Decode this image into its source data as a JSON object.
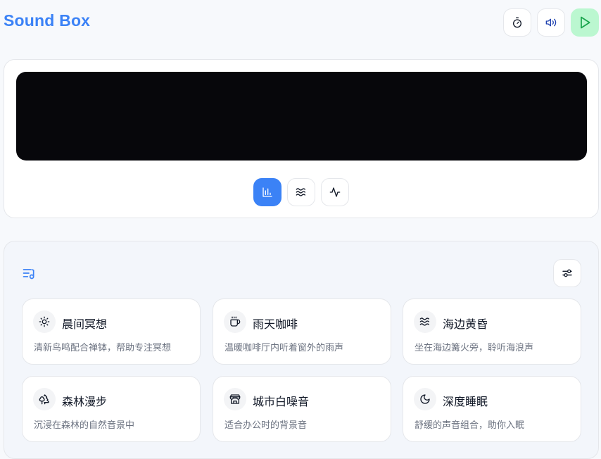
{
  "header": {
    "title": "Sound Box",
    "buttons": [
      {
        "icon": "timer-icon"
      },
      {
        "icon": "volume-icon"
      },
      {
        "icon": "play-icon"
      }
    ]
  },
  "visualizer": {
    "modes": [
      {
        "icon": "bar-chart-icon",
        "active": true
      },
      {
        "icon": "waves-icon",
        "active": false
      },
      {
        "icon": "activity-icon",
        "active": false
      }
    ]
  },
  "scenes": [
    {
      "icon": "sun-icon",
      "name": "晨间冥想",
      "desc": "清新鸟鸣配合禅钵，帮助专注冥想"
    },
    {
      "icon": "coffee-icon",
      "name": "雨天咖啡",
      "desc": "温暖咖啡厅内听着窗外的雨声"
    },
    {
      "icon": "waves-icon",
      "name": "海边黄昏",
      "desc": "坐在海边篝火旁，聆听海浪声"
    },
    {
      "icon": "trees-icon",
      "name": "森林漫步",
      "desc": "沉浸在森林的自然音景中"
    },
    {
      "icon": "store-icon",
      "name": "城市白噪音",
      "desc": "适合办公时的背景音"
    },
    {
      "icon": "moon-icon",
      "name": "深度睡眠",
      "desc": "舒缓的声音组合，助你入眠"
    }
  ],
  "colors": {
    "accent": "#3b82f6",
    "play": "#16a34a",
    "play_bg": "#bbf7d0"
  }
}
